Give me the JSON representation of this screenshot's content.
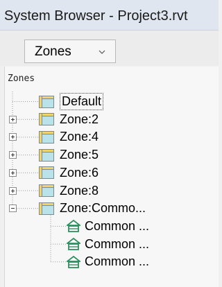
{
  "window": {
    "title": "System Browser - Project3.rvt"
  },
  "toolbar": {
    "view_selector": "Zones"
  },
  "tree": {
    "root_label": "Zones",
    "items": [
      {
        "label": "Default",
        "expander": "none",
        "icon": "zone-icon"
      },
      {
        "label": "Zone:2",
        "expander": "plus",
        "icon": "zone-icon"
      },
      {
        "label": "Zone:4",
        "expander": "plus",
        "icon": "zone-icon"
      },
      {
        "label": "Zone:5",
        "expander": "plus",
        "icon": "zone-icon"
      },
      {
        "label": "Zone:6",
        "expander": "plus",
        "icon": "zone-icon"
      },
      {
        "label": "Zone:8",
        "expander": "plus",
        "icon": "zone-icon"
      },
      {
        "label": "Zone:Commo...",
        "expander": "minus",
        "icon": "zone-icon",
        "children": [
          {
            "label": "Common ...",
            "icon": "space-icon"
          },
          {
            "label": "Common ...",
            "icon": "space-icon"
          },
          {
            "label": "Common ...",
            "icon": "space-icon"
          }
        ]
      }
    ]
  },
  "colors": {
    "titlebar": "#dfe6ef",
    "zone_icon_header": "#f2d36b",
    "zone_icon_body": "#b9e3e9",
    "space_icon": "#2e8f5e"
  }
}
